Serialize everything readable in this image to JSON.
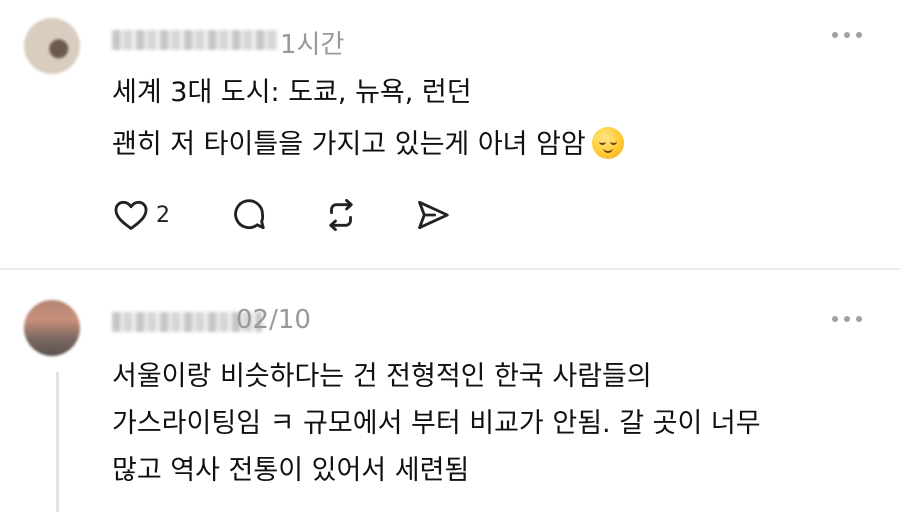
{
  "posts": [
    {
      "time": "1시간",
      "lines": [
        "세계 3대 도시: 도쿄, 뉴욕, 런던",
        "괜히 저 타이틀을 가지고 있는게 아녀 암암"
      ],
      "emoji": "relieved-face-emoji",
      "likes": "2",
      "actions": [
        "heart-icon",
        "comment-icon",
        "repost-icon",
        "share-icon"
      ]
    },
    {
      "time": "02/10",
      "lines": [
        "서울이랑 비슷하다는 건 전형적인 한국 사람들의",
        "가스라이팅임 ㅋ 규모에서 부터 비교가 안됨. 갈 곳이 너무",
        "많고 역사 전통이 있어서 세련됨"
      ]
    }
  ],
  "colors": {
    "text": "#111111",
    "meta": "#999999",
    "divider": "#ececec"
  }
}
